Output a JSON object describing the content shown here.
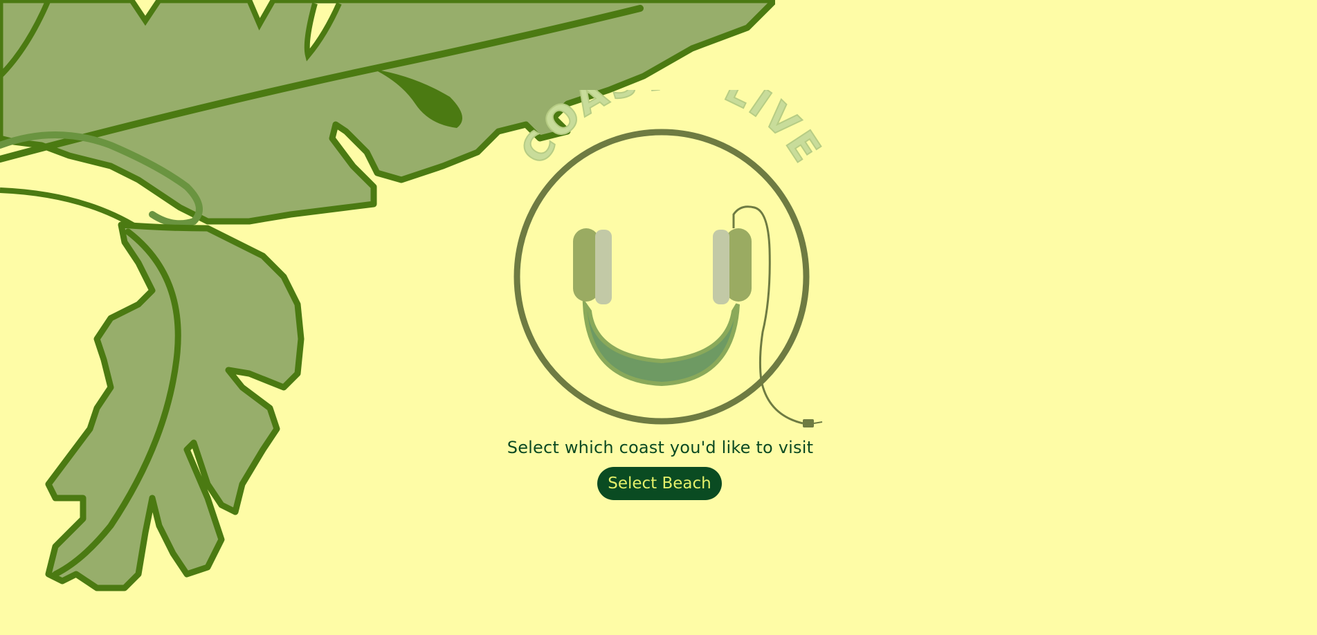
{
  "background_color": "#fefca6",
  "logo": {
    "wordmark": "COAST - LIVE",
    "icon": "headphones-smiley-icon",
    "accent_color": "#6e7b42"
  },
  "leaves": {
    "icon": "banana-leaf-illustration",
    "fill_color": "#97ae6b",
    "outline_color": "#4b7a12"
  },
  "main": {
    "prompt": "Select which coast you'd like to visit",
    "button_label": "Select Beach",
    "button_color": "#0a4b22",
    "button_text_color": "#e4f06a"
  }
}
